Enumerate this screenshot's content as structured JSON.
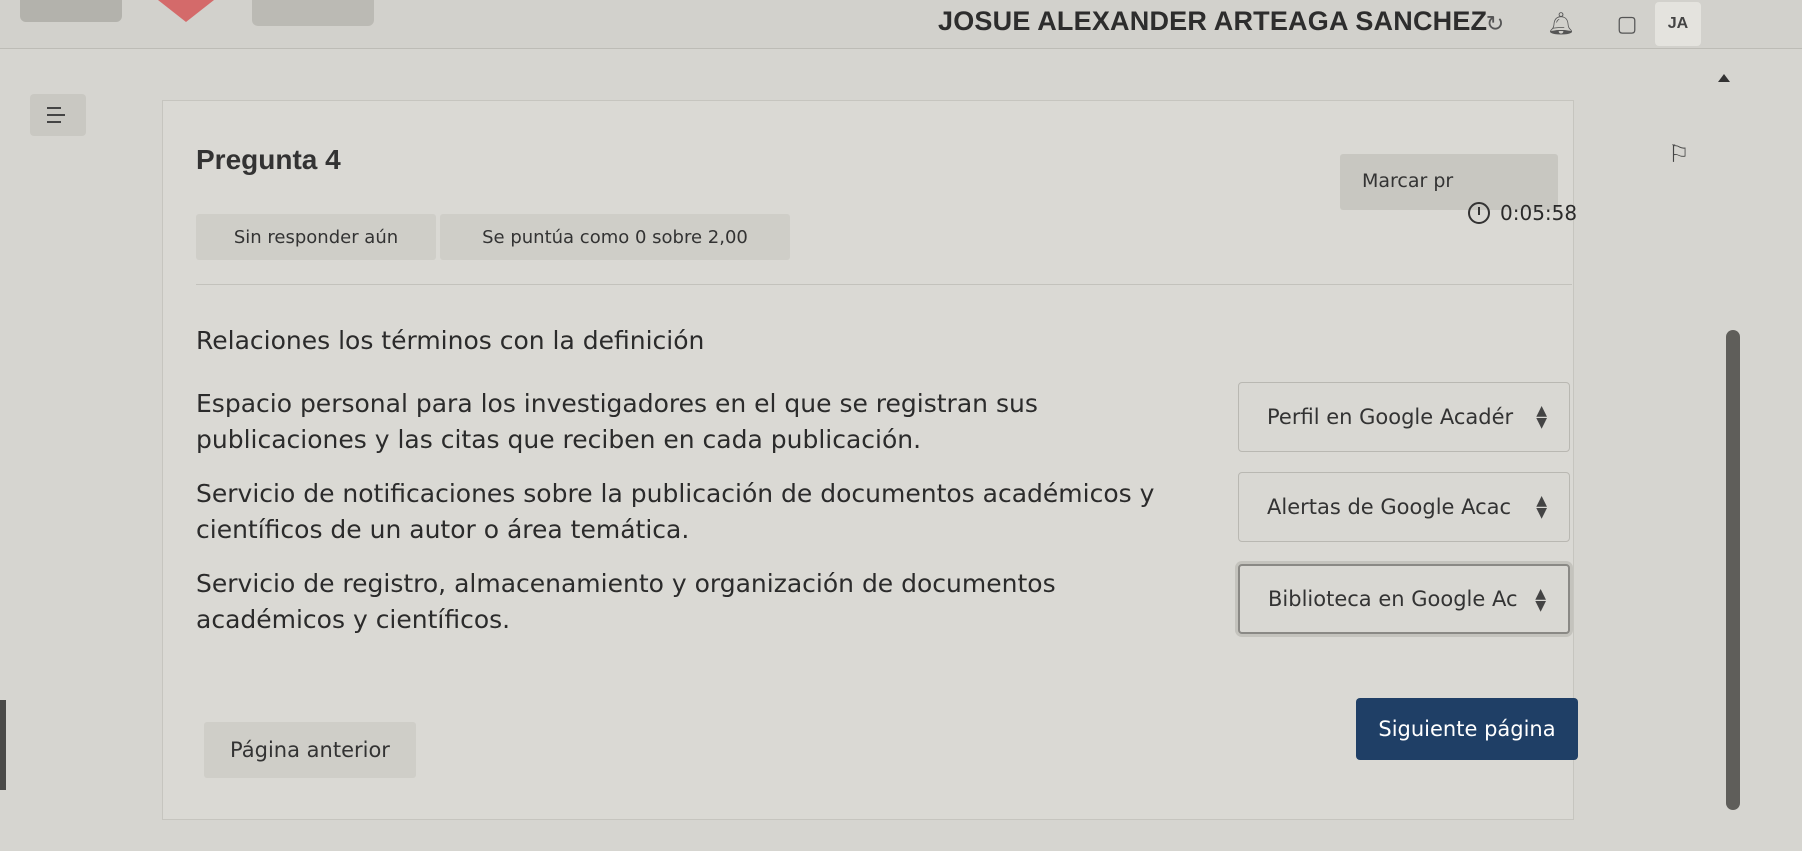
{
  "header": {
    "user_name": "JOSUE ALEXANDER ARTEAGA SANCHEZ",
    "avatar_initials": "JA",
    "icons": [
      "history-icon",
      "bell-icon",
      "chat-icon"
    ]
  },
  "question": {
    "title": "Pregunta 4",
    "status": "Sin responder aún",
    "score": "Se puntúa como 0 sobre 2,00",
    "flag_label": "Marcar pr",
    "timer": "0:05:58",
    "prompt": "Relaciones los términos con la definición",
    "items": [
      {
        "definition": "Espacio personal para los investigadores en el que se registran sus publicaciones y las citas que reciben en cada publicación.",
        "selected": "Perfil en Google Acadér"
      },
      {
        "definition": "Servicio de notificaciones sobre la publicación de documentos académicos y científicos de un autor o área temática.",
        "selected": "Alertas de Google Acac"
      },
      {
        "definition": "Servicio de registro, almacenamiento y organización de documentos académicos y científicos.",
        "selected": "Biblioteca en Google Ac"
      }
    ]
  },
  "navigation": {
    "prev_label": "Página anterior",
    "next_label": "Siguiente página"
  },
  "colors": {
    "primary_button": "#1f3f66",
    "background": "#d6d5d0"
  }
}
